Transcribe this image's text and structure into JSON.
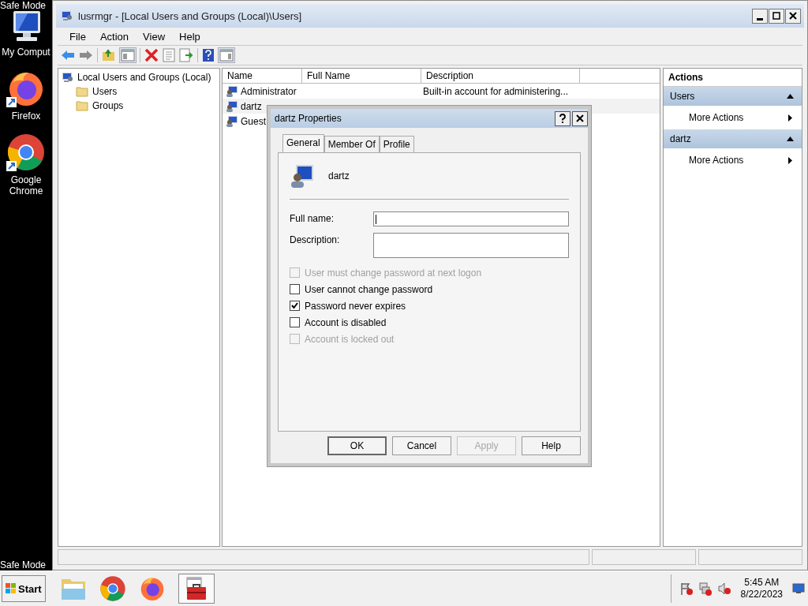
{
  "desktop": {
    "top_label": "Safe Mode",
    "icons": [
      {
        "label": "My Comput",
        "kind": "computer"
      },
      {
        "label": "Firefox",
        "kind": "firefox"
      },
      {
        "label": "Google Chrome",
        "kind": "chrome"
      }
    ],
    "bottom_label": "Safe Mode"
  },
  "window": {
    "title": "lusrmgr - [Local Users and Groups (Local)\\Users]"
  },
  "menu": [
    "File",
    "Action",
    "View",
    "Help"
  ],
  "tree": [
    {
      "label": "Local Users and Groups (Local)",
      "kind": "computer",
      "children": [
        {
          "label": "Users",
          "kind": "folder"
        },
        {
          "label": "Groups",
          "kind": "folder"
        }
      ]
    }
  ],
  "table": {
    "columns": [
      "Name",
      "Full Name",
      "Description"
    ],
    "rows": [
      {
        "name": "Administrator",
        "description": "Built-in account for administering...",
        "selected": false
      },
      {
        "name": "dartz",
        "selected": true
      },
      {
        "name": "Guest",
        "selected": false
      }
    ]
  },
  "actions": {
    "title": "Actions",
    "sections": [
      {
        "title": "Users",
        "items": [
          "More Actions"
        ]
      },
      {
        "title": "dartz",
        "items": [
          "More Actions"
        ]
      }
    ]
  },
  "dialog": {
    "title": "dartz Properties",
    "tabs": [
      {
        "label": "General",
        "selected": true
      },
      {
        "label": "Member Of",
        "selected": false
      },
      {
        "label": "Profile",
        "selected": false
      }
    ],
    "user": "dartz",
    "fields": [
      {
        "label": "Full name:",
        "focused": true,
        "kind": "line"
      },
      {
        "label": "Description:",
        "focused": false,
        "kind": "box"
      }
    ],
    "checkboxes": [
      {
        "label": "User must change password at next logon",
        "checked": false,
        "disabled": true
      },
      {
        "label": "User cannot change password",
        "checked": false,
        "disabled": false
      },
      {
        "label": "Password never expires",
        "checked": true,
        "disabled": false
      },
      {
        "label": "Account is disabled",
        "checked": false,
        "disabled": false
      },
      {
        "label": "Account is locked out",
        "checked": false,
        "disabled": true
      }
    ],
    "buttons": [
      {
        "label": "OK",
        "disabled": false,
        "default": true
      },
      {
        "label": "Cancel",
        "disabled": false,
        "default": false
      },
      {
        "label": "Apply",
        "disabled": true,
        "default": false
      },
      {
        "label": "Help",
        "disabled": false,
        "default": false
      }
    ]
  },
  "taskbar": {
    "start": "Start",
    "quick_launch": [
      {
        "kind": "folder"
      },
      {
        "kind": "chrome"
      },
      {
        "kind": "firefox"
      }
    ],
    "tasks": [
      {
        "kind": "toolbox",
        "selected": true
      }
    ],
    "time": "5:45 AM",
    "date": "8/22/2023"
  }
}
